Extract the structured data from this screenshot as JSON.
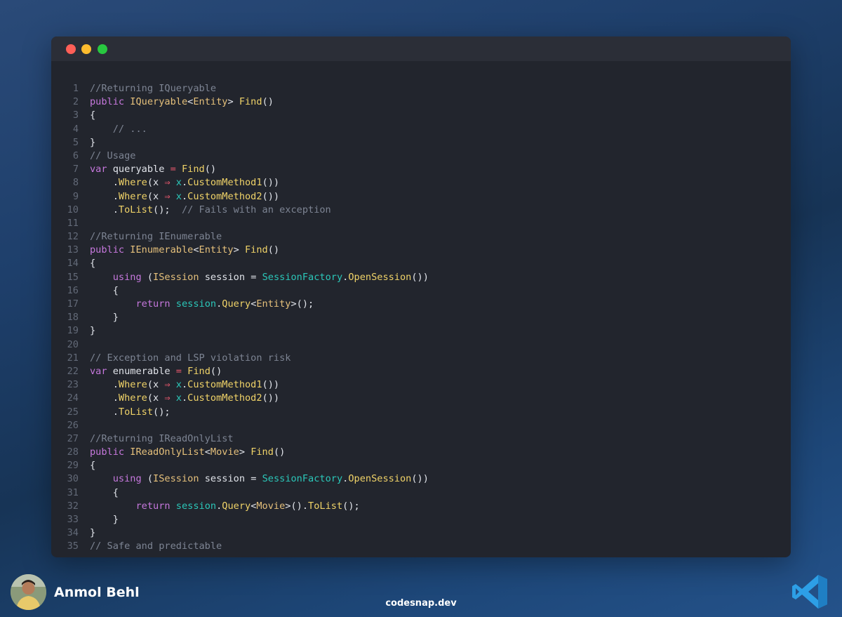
{
  "window": {
    "controls": [
      "close",
      "minimize",
      "maximize"
    ]
  },
  "code_lines": [
    {
      "n": "1",
      "tokens": [
        {
          "t": "//Returning IQueryable",
          "c": "com"
        }
      ]
    },
    {
      "n": "2",
      "tokens": [
        {
          "t": "public ",
          "c": "kw"
        },
        {
          "t": "IQueryable",
          "c": "ty"
        },
        {
          "t": "<",
          "c": "pl"
        },
        {
          "t": "Entity",
          "c": "ty"
        },
        {
          "t": "> ",
          "c": "pl"
        },
        {
          "t": "Find",
          "c": "fn"
        },
        {
          "t": "()",
          "c": "pl"
        }
      ]
    },
    {
      "n": "3",
      "tokens": [
        {
          "t": "{",
          "c": "pl"
        }
      ]
    },
    {
      "n": "4",
      "tokens": [
        {
          "t": "    // ...",
          "c": "com"
        }
      ]
    },
    {
      "n": "5",
      "tokens": [
        {
          "t": "}",
          "c": "pl"
        }
      ]
    },
    {
      "n": "6",
      "tokens": [
        {
          "t": "// Usage",
          "c": "com"
        }
      ]
    },
    {
      "n": "7",
      "tokens": [
        {
          "t": "var ",
          "c": "kw"
        },
        {
          "t": "queryable ",
          "c": "pl"
        },
        {
          "t": "= ",
          "c": "op"
        },
        {
          "t": "Find",
          "c": "fn"
        },
        {
          "t": "()",
          "c": "pl"
        }
      ]
    },
    {
      "n": "8",
      "tokens": [
        {
          "t": "    .",
          "c": "pl"
        },
        {
          "t": "Where",
          "c": "fn"
        },
        {
          "t": "(x ",
          "c": "pl"
        },
        {
          "t": "⇒ ",
          "c": "op"
        },
        {
          "t": "x",
          "c": "var"
        },
        {
          "t": ".",
          "c": "pl"
        },
        {
          "t": "CustomMethod1",
          "c": "fn"
        },
        {
          "t": "())",
          "c": "pl"
        }
      ]
    },
    {
      "n": "9",
      "tokens": [
        {
          "t": "    .",
          "c": "pl"
        },
        {
          "t": "Where",
          "c": "fn"
        },
        {
          "t": "(x ",
          "c": "pl"
        },
        {
          "t": "⇒ ",
          "c": "op"
        },
        {
          "t": "x",
          "c": "var"
        },
        {
          "t": ".",
          "c": "pl"
        },
        {
          "t": "CustomMethod2",
          "c": "fn"
        },
        {
          "t": "())",
          "c": "pl"
        }
      ]
    },
    {
      "n": "10",
      "tokens": [
        {
          "t": "    .",
          "c": "pl"
        },
        {
          "t": "ToList",
          "c": "fn"
        },
        {
          "t": "();  ",
          "c": "pl"
        },
        {
          "t": "// Fails with an exception",
          "c": "com"
        }
      ]
    },
    {
      "n": "11",
      "tokens": []
    },
    {
      "n": "12",
      "tokens": [
        {
          "t": "//Returning IEnumerable",
          "c": "com"
        }
      ]
    },
    {
      "n": "13",
      "tokens": [
        {
          "t": "public ",
          "c": "kw"
        },
        {
          "t": "IEnumerable",
          "c": "ty"
        },
        {
          "t": "<",
          "c": "pl"
        },
        {
          "t": "Entity",
          "c": "ty"
        },
        {
          "t": "> ",
          "c": "pl"
        },
        {
          "t": "Find",
          "c": "fn"
        },
        {
          "t": "()",
          "c": "pl"
        }
      ]
    },
    {
      "n": "14",
      "tokens": [
        {
          "t": "{",
          "c": "pl"
        }
      ]
    },
    {
      "n": "15",
      "tokens": [
        {
          "t": "    ",
          "c": "pl"
        },
        {
          "t": "using ",
          "c": "kw"
        },
        {
          "t": "(",
          "c": "pl"
        },
        {
          "t": "ISession ",
          "c": "ty"
        },
        {
          "t": "session ",
          "c": "pl"
        },
        {
          "t": "= ",
          "c": "pl"
        },
        {
          "t": "SessionFactory",
          "c": "var"
        },
        {
          "t": ".",
          "c": "pl"
        },
        {
          "t": "OpenSession",
          "c": "fn"
        },
        {
          "t": "())",
          "c": "pl"
        }
      ]
    },
    {
      "n": "16",
      "tokens": [
        {
          "t": "    {",
          "c": "pl"
        }
      ]
    },
    {
      "n": "17",
      "tokens": [
        {
          "t": "        ",
          "c": "pl"
        },
        {
          "t": "return ",
          "c": "kw"
        },
        {
          "t": "session",
          "c": "var"
        },
        {
          "t": ".",
          "c": "pl"
        },
        {
          "t": "Query",
          "c": "fn"
        },
        {
          "t": "<",
          "c": "pl"
        },
        {
          "t": "Entity",
          "c": "ty"
        },
        {
          "t": ">();",
          "c": "pl"
        }
      ]
    },
    {
      "n": "18",
      "tokens": [
        {
          "t": "    }",
          "c": "pl"
        }
      ]
    },
    {
      "n": "19",
      "tokens": [
        {
          "t": "}",
          "c": "pl"
        }
      ]
    },
    {
      "n": "20",
      "tokens": []
    },
    {
      "n": "21",
      "tokens": [
        {
          "t": "// Exception and LSP violation risk",
          "c": "com"
        }
      ]
    },
    {
      "n": "22",
      "tokens": [
        {
          "t": "var ",
          "c": "kw"
        },
        {
          "t": "enumerable ",
          "c": "pl"
        },
        {
          "t": "= ",
          "c": "op"
        },
        {
          "t": "Find",
          "c": "fn"
        },
        {
          "t": "()",
          "c": "pl"
        }
      ]
    },
    {
      "n": "23",
      "tokens": [
        {
          "t": "    .",
          "c": "pl"
        },
        {
          "t": "Where",
          "c": "fn"
        },
        {
          "t": "(x ",
          "c": "pl"
        },
        {
          "t": "⇒ ",
          "c": "op"
        },
        {
          "t": "x",
          "c": "var"
        },
        {
          "t": ".",
          "c": "pl"
        },
        {
          "t": "CustomMethod1",
          "c": "fn"
        },
        {
          "t": "())",
          "c": "pl"
        }
      ]
    },
    {
      "n": "24",
      "tokens": [
        {
          "t": "    .",
          "c": "pl"
        },
        {
          "t": "Where",
          "c": "fn"
        },
        {
          "t": "(x ",
          "c": "pl"
        },
        {
          "t": "⇒ ",
          "c": "op"
        },
        {
          "t": "x",
          "c": "var"
        },
        {
          "t": ".",
          "c": "pl"
        },
        {
          "t": "CustomMethod2",
          "c": "fn"
        },
        {
          "t": "())",
          "c": "pl"
        }
      ]
    },
    {
      "n": "25",
      "tokens": [
        {
          "t": "    .",
          "c": "pl"
        },
        {
          "t": "ToList",
          "c": "fn"
        },
        {
          "t": "();",
          "c": "pl"
        }
      ]
    },
    {
      "n": "26",
      "tokens": []
    },
    {
      "n": "27",
      "tokens": [
        {
          "t": "//Returning IReadOnlyList",
          "c": "com"
        }
      ]
    },
    {
      "n": "28",
      "tokens": [
        {
          "t": "public ",
          "c": "kw"
        },
        {
          "t": "IReadOnlyList",
          "c": "ty"
        },
        {
          "t": "<",
          "c": "pl"
        },
        {
          "t": "Movie",
          "c": "ty"
        },
        {
          "t": "> ",
          "c": "pl"
        },
        {
          "t": "Find",
          "c": "fn"
        },
        {
          "t": "()",
          "c": "pl"
        }
      ]
    },
    {
      "n": "29",
      "tokens": [
        {
          "t": "{",
          "c": "pl"
        }
      ]
    },
    {
      "n": "30",
      "tokens": [
        {
          "t": "    ",
          "c": "pl"
        },
        {
          "t": "using ",
          "c": "kw"
        },
        {
          "t": "(",
          "c": "pl"
        },
        {
          "t": "ISession ",
          "c": "ty"
        },
        {
          "t": "session ",
          "c": "pl"
        },
        {
          "t": "= ",
          "c": "pl"
        },
        {
          "t": "SessionFactory",
          "c": "var"
        },
        {
          "t": ".",
          "c": "pl"
        },
        {
          "t": "OpenSession",
          "c": "fn"
        },
        {
          "t": "())",
          "c": "pl"
        }
      ]
    },
    {
      "n": "31",
      "tokens": [
        {
          "t": "    {",
          "c": "pl"
        }
      ]
    },
    {
      "n": "32",
      "tokens": [
        {
          "t": "        ",
          "c": "pl"
        },
        {
          "t": "return ",
          "c": "kw"
        },
        {
          "t": "session",
          "c": "var"
        },
        {
          "t": ".",
          "c": "pl"
        },
        {
          "t": "Query",
          "c": "fn"
        },
        {
          "t": "<",
          "c": "pl"
        },
        {
          "t": "Movie",
          "c": "ty"
        },
        {
          "t": ">().",
          "c": "pl"
        },
        {
          "t": "ToList",
          "c": "fn"
        },
        {
          "t": "();",
          "c": "pl"
        }
      ]
    },
    {
      "n": "33",
      "tokens": [
        {
          "t": "    }",
          "c": "pl"
        }
      ]
    },
    {
      "n": "34",
      "tokens": [
        {
          "t": "}",
          "c": "pl"
        }
      ]
    },
    {
      "n": "35",
      "tokens": [
        {
          "t": "// Safe and predictable",
          "c": "com"
        }
      ]
    }
  ],
  "footer": {
    "author_name": "Anmol Behl",
    "site": "codesnap.dev",
    "logo_icon": "vscode-icon"
  },
  "colors": {
    "comment": "#7d8493",
    "keyword": "#c678dd",
    "type": "#e5c07b",
    "function": "#f0d368",
    "operator": "#ef596f",
    "identifier": "#2bc7b9",
    "text": "#e1e4ea"
  }
}
